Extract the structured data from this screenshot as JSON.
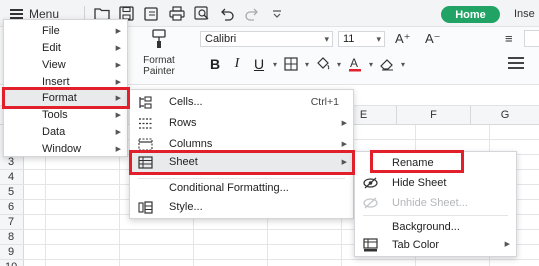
{
  "toolbar": {
    "menu_label": "Menu",
    "home_tab": "Home",
    "insert_tab": "Inse"
  },
  "ribbon": {
    "format_painter": "Format Painter",
    "font_name": "Calibri",
    "font_size": "11",
    "bold": "B",
    "italic": "I",
    "underline": "U",
    "font_color_letter": "A",
    "grow_font": "A⁺",
    "shrink_font": "A⁻"
  },
  "sheet": {
    "columns": [
      "E",
      "F",
      "G"
    ],
    "rows": [
      "3",
      "4",
      "5",
      "6",
      "7",
      "8",
      "9",
      "10"
    ]
  },
  "main_menu": {
    "items": [
      {
        "label": "File",
        "has_submenu": true
      },
      {
        "label": "Edit",
        "has_submenu": true
      },
      {
        "label": "View",
        "has_submenu": true
      },
      {
        "label": "Insert",
        "has_submenu": true
      },
      {
        "label": "Format",
        "has_submenu": true,
        "active": true
      },
      {
        "label": "Tools",
        "has_submenu": true
      },
      {
        "label": "Data",
        "has_submenu": true
      },
      {
        "label": "Window",
        "has_submenu": true
      }
    ]
  },
  "format_menu": {
    "items": [
      {
        "label": "Cells...",
        "icon": "cells-icon",
        "shortcut": "Ctrl+1"
      },
      {
        "label": "Rows",
        "icon": "rows-icon",
        "has_submenu": true
      },
      {
        "label": "Columns",
        "icon": "columns-icon",
        "has_submenu": true
      },
      {
        "label": "Sheet",
        "icon": "sheet-icon",
        "has_submenu": true,
        "active": true
      },
      {
        "label": "Conditional Formatting...",
        "icon": ""
      },
      {
        "label": "Style...",
        "icon": "style-icon"
      }
    ]
  },
  "sheet_menu": {
    "items": [
      {
        "label": "Rename",
        "icon": ""
      },
      {
        "label": "Hide Sheet",
        "icon": "hide-sheet-icon"
      },
      {
        "label": "Unhide Sheet...",
        "icon": "unhide-sheet-icon",
        "disabled": true
      },
      {
        "label": "Background...",
        "icon": ""
      },
      {
        "label": "Tab Color",
        "icon": "tab-color-icon",
        "has_submenu": true
      }
    ]
  },
  "colors": {
    "accent_green": "#21a366",
    "highlight_red": "#e2202c",
    "font_color_red": "#e2202c"
  }
}
